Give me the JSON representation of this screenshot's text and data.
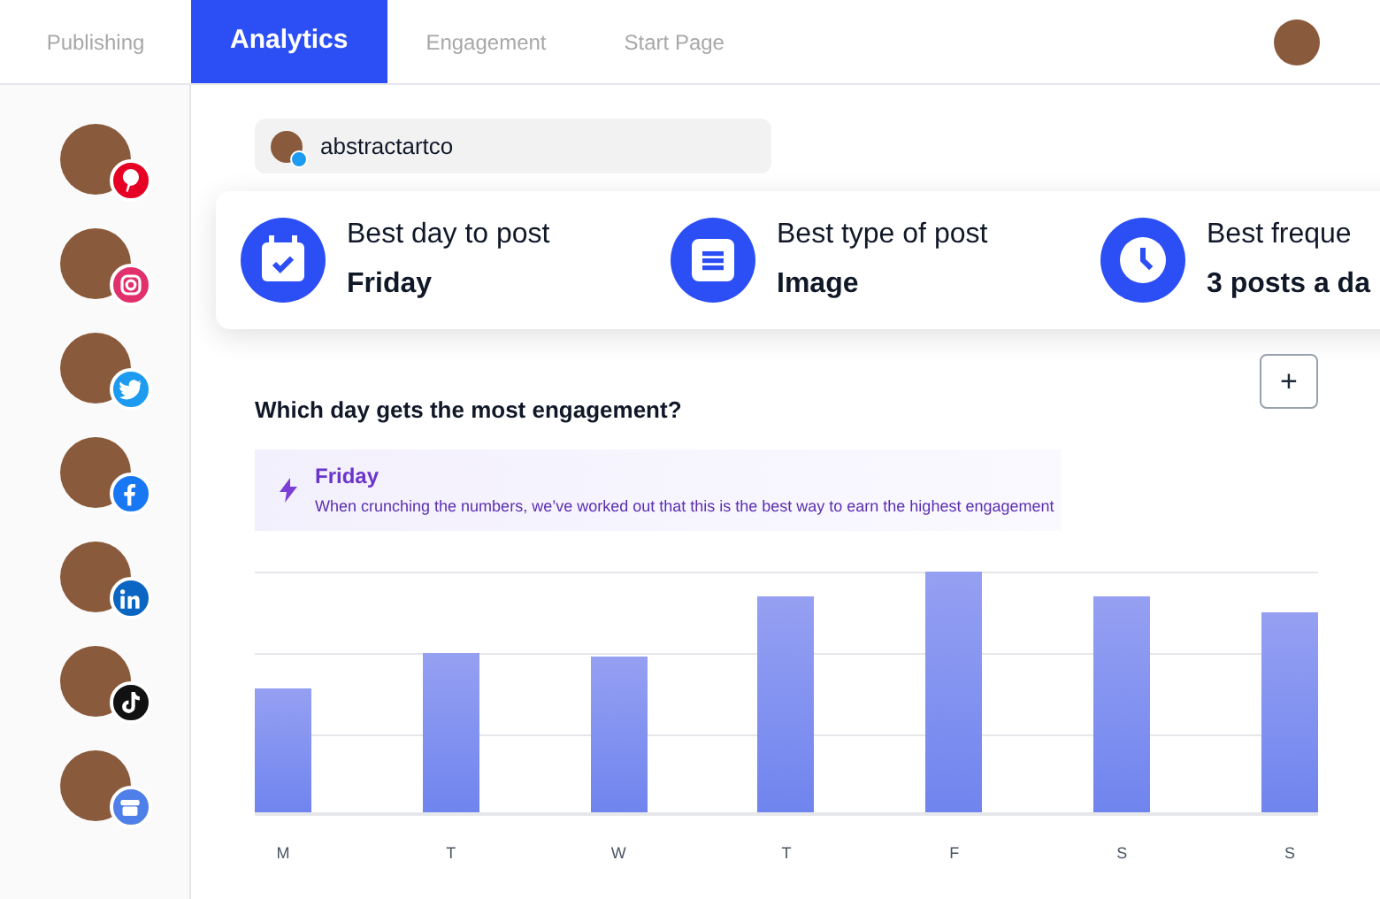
{
  "tabs": [
    {
      "label": "Publishing",
      "selected": false
    },
    {
      "label": "Analytics",
      "selected": true
    },
    {
      "label": "Engagement",
      "selected": false
    },
    {
      "label": "Start Page",
      "selected": false
    }
  ],
  "sidebar": {
    "accounts": [
      {
        "kind": "pinterest"
      },
      {
        "kind": "instagram"
      },
      {
        "kind": "twitter"
      },
      {
        "kind": "facebook"
      },
      {
        "kind": "linkedin"
      },
      {
        "kind": "tiktok"
      },
      {
        "kind": "business"
      }
    ]
  },
  "account_chip": {
    "kind": "twitter",
    "name": "abstractartco"
  },
  "summary_card": {
    "items": [
      {
        "kind": "calendar",
        "label": "Best day to post",
        "value": "Friday"
      },
      {
        "kind": "document",
        "label": "Best type of post",
        "value": "Image"
      },
      {
        "kind": "clock",
        "label": "Best freque",
        "value": "3 posts a da"
      }
    ]
  },
  "engagement": {
    "add_button": "+",
    "heading": "Which day gets the most engagement?",
    "insight": {
      "title": "Friday",
      "text": "When crunching the numbers, we’ve worked out that this is the best way to earn the highest engagement"
    },
    "day_labels": [
      "M",
      "T",
      "W",
      "T",
      "F",
      "S",
      "S"
    ]
  }
}
